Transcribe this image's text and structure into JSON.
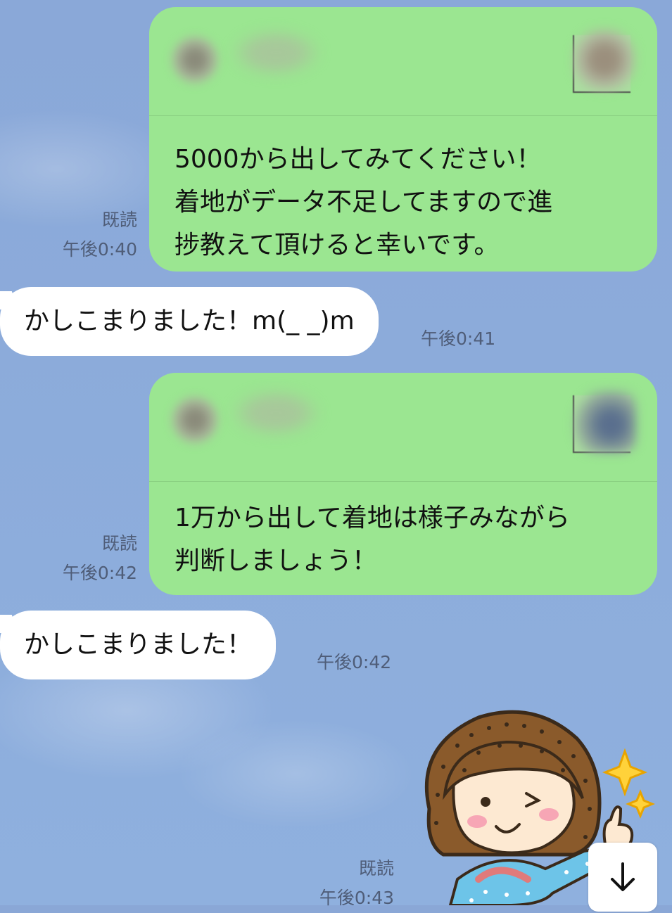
{
  "messages": [
    {
      "from": "me",
      "text": "5000から出してみてください！\n着地がデータ不足してますので進\n捗教えて頂けると幸いです。",
      "status": "既読",
      "time": "午後0:40"
    },
    {
      "from": "other",
      "text": "かしこまりました！m(_ _)m",
      "time": "午後0:41"
    },
    {
      "from": "me",
      "text": "1万から出して着地は様子みながら\n判断しましょう！",
      "status": "既読",
      "time": "午後0:42"
    },
    {
      "from": "other",
      "text": "かしこまりました！",
      "time": "午後0:42"
    },
    {
      "from": "me",
      "type": "sticker",
      "sticker": "girl-thumbs-up-wink-sticker",
      "status": "既読",
      "time": "午後0:43"
    }
  ],
  "scroll_button": {
    "icon": "arrow-down-icon"
  },
  "colors": {
    "background": "#8aa7d6",
    "outgoing_bubble": "#9be691",
    "incoming_bubble": "#ffffff",
    "meta_text": "#4f5d78"
  }
}
